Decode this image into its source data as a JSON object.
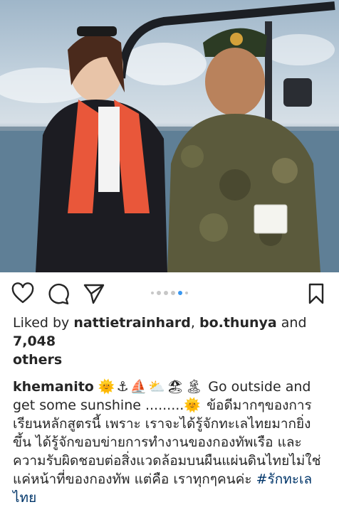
{
  "post": {
    "photo_alt": "",
    "carousel": {
      "count": 6,
      "active_index": 4
    },
    "likes": {
      "prefix": "Liked by ",
      "user1": "nattietrainhard",
      "sep": ", ",
      "user2": "bo.thunya",
      "and": " and ",
      "count": "7,048",
      "suffix": "others"
    },
    "caption": {
      "username": "khemanito",
      "emojis": [
        "🌞",
        "⚓",
        "⛵",
        "⛅",
        "🏖",
        "🏝"
      ],
      "text_en": "Go outside and get some sunshine .........",
      "sun": "🌞",
      "text_th": "ข้อดีมากๆของการเรียนหลักสูตรนี้ เพราะ เราจะได้รู้จักทะเลไทยมากยิ่งขึ้น ได้รู้จักขอบข่ายการทำงานของกองทัพเรือ และความรับผิดชอบต่อสิ่งแวดล้อมบนผืนแผ่นดินไทยไม่ใช่แค่หน้าที่ของกองทัพ แต่คือ เราทุกๆคนค่ะ ",
      "hashtag": "#รักทะเลไทย"
    },
    "colors": {
      "accent": "#3897f0",
      "hashtag": "#003569",
      "text": "#262626"
    }
  }
}
